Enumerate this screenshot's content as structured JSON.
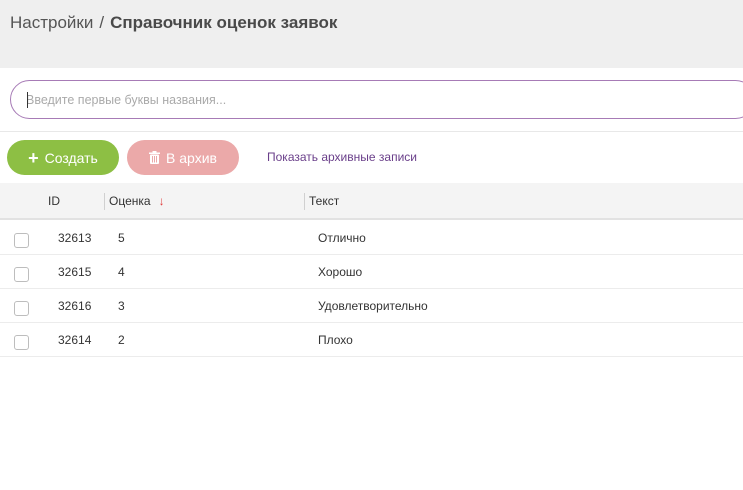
{
  "breadcrumb": {
    "parent": "Настройки",
    "separator": "/",
    "current": "Справочник оценок заявок"
  },
  "search": {
    "value": "",
    "placeholder": "Введите первые буквы названия..."
  },
  "toolbar": {
    "create_label": "Создать",
    "create_icon": "plus-icon",
    "archive_label": "В архив",
    "archive_icon": "trash-icon",
    "show_archived_label": "Показать архивные записи"
  },
  "table": {
    "columns": [
      {
        "key": "id",
        "label": "ID"
      },
      {
        "key": "score",
        "label": "Оценка",
        "sort": "desc"
      },
      {
        "key": "text",
        "label": "Текст"
      }
    ],
    "rows": [
      {
        "id": "32613",
        "score": "5",
        "text": "Отлично"
      },
      {
        "id": "32615",
        "score": "4",
        "text": "Хорошо"
      },
      {
        "id": "32616",
        "score": "3",
        "text": "Удовлетворительно"
      },
      {
        "id": "32614",
        "score": "2",
        "text": "Плохо"
      }
    ]
  },
  "colors": {
    "create_button": "#8dbf44",
    "archive_button": "#eba9a9",
    "link": "#6a3f8a",
    "search_border": "#a77bb6",
    "sort_arrow": "#e03d3d"
  }
}
